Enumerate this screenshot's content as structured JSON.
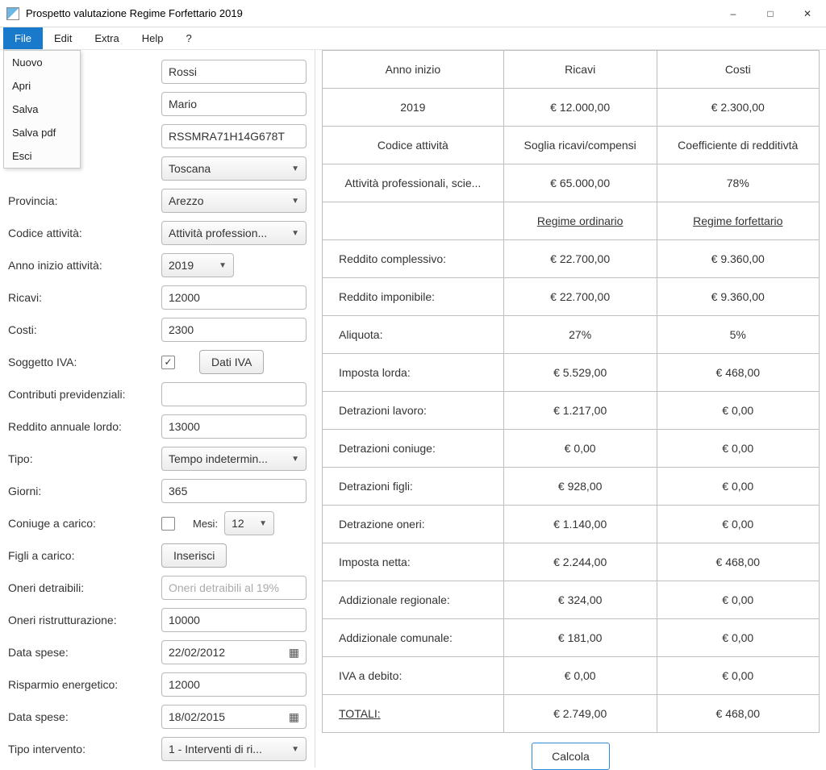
{
  "window": {
    "title": "Prospetto valutazione Regime Forfettario 2019"
  },
  "menubar": {
    "file": "File",
    "edit": "Edit",
    "extra": "Extra",
    "help": "Help",
    "q": "?"
  },
  "file_menu": {
    "nuovo": "Nuovo",
    "apri": "Apri",
    "salva": "Salva",
    "salva_pdf": "Salva pdf",
    "esci": "Esci"
  },
  "form": {
    "cognome": {
      "value": "Rossi"
    },
    "nome": {
      "value": "Mario"
    },
    "cf": {
      "label_suffix": ":",
      "value": "RSSMRA71H14G678T"
    },
    "regione": {
      "value": "Toscana"
    },
    "provincia": {
      "label": "Provincia:",
      "value": "Arezzo"
    },
    "codice_attivita": {
      "label": "Codice attività:",
      "value": "Attività profession..."
    },
    "anno_inizio": {
      "label": "Anno inizio attività:",
      "value": "2019"
    },
    "ricavi": {
      "label": "Ricavi:",
      "value": "12000"
    },
    "costi": {
      "label": "Costi:",
      "value": "2300"
    },
    "soggetto_iva": {
      "label": "Soggetto IVA:",
      "checked": "✓",
      "dati_iva": "Dati IVA"
    },
    "contributi": {
      "label": "Contributi previdenziali:",
      "value": ""
    },
    "reddito_lordo": {
      "label": "Reddito annuale lordo:",
      "value": "13000"
    },
    "tipo": {
      "label": "Tipo:",
      "value": "Tempo indetermin..."
    },
    "giorni": {
      "label": "Giorni:",
      "value": "365"
    },
    "coniuge": {
      "label": "Coniuge a carico:",
      "mesi_label": "Mesi:",
      "mesi_value": "12"
    },
    "figli": {
      "label": "Figli a carico:",
      "btn": "Inserisci"
    },
    "oneri_detraibili": {
      "label": "Oneri detraibili:",
      "placeholder": "Oneri detraibili al 19%"
    },
    "oneri_ristr": {
      "label": "Oneri ristrutturazione:",
      "value": "10000"
    },
    "data_spese1": {
      "label": "Data spese:",
      "value": "22/02/2012"
    },
    "risparmio": {
      "label": "Risparmio energetico:",
      "value": "12000"
    },
    "data_spese2": {
      "label": "Data spese:",
      "value": "18/02/2015"
    },
    "tipo_intervento": {
      "label": "Tipo intervento:",
      "value": "1 - Interventi di ri..."
    }
  },
  "results": {
    "headers1": {
      "anno": "Anno inizio",
      "ricavi": "Ricavi",
      "costi": "Costi"
    },
    "row1": {
      "anno": "2019",
      "ricavi": "€ 12.000,00",
      "costi": "€ 2.300,00"
    },
    "headers2": {
      "codice": "Codice attività",
      "soglia": "Soglia ricavi/compensi",
      "coef": "Coefficiente di redditivtà"
    },
    "row2": {
      "codice": "Attività professionali, scie...",
      "soglia": "€ 65.000,00",
      "coef": "78%"
    },
    "regimes": {
      "empty": "",
      "ord": "Regime ordinario",
      "forf": "Regime forfettario"
    },
    "rows": [
      {
        "label": "Reddito complessivo:",
        "ord": "€ 22.700,00",
        "forf": "€ 9.360,00"
      },
      {
        "label": "Reddito imponibile:",
        "ord": "€ 22.700,00",
        "forf": "€ 9.360,00"
      },
      {
        "label": "Aliquota:",
        "ord": "27%",
        "forf": "5%"
      },
      {
        "label": "Imposta lorda:",
        "ord": "€ 5.529,00",
        "forf": "€ 468,00"
      },
      {
        "label": "Detrazioni lavoro:",
        "ord": "€ 1.217,00",
        "forf": "€ 0,00"
      },
      {
        "label": "Detrazioni coniuge:",
        "ord": "€ 0,00",
        "forf": "€ 0,00"
      },
      {
        "label": "Detrazioni figli:",
        "ord": "€ 928,00",
        "forf": "€ 0,00"
      },
      {
        "label": "Detrazione oneri:",
        "ord": "€ 1.140,00",
        "forf": "€ 0,00"
      },
      {
        "label": "Imposta netta:",
        "ord": "€ 2.244,00",
        "forf": "€ 468,00"
      },
      {
        "label": "Addizionale regionale:",
        "ord": "€ 324,00",
        "forf": "€ 0,00"
      },
      {
        "label": "Addizionale comunale:",
        "ord": "€ 181,00",
        "forf": "€ 0,00"
      },
      {
        "label": "IVA a debito:",
        "ord": "€ 0,00",
        "forf": "€ 0,00"
      }
    ],
    "total": {
      "label": "TOTALI:",
      "ord": "€ 2.749,00",
      "forf": "€ 468,00"
    },
    "calcola": "Calcola"
  }
}
